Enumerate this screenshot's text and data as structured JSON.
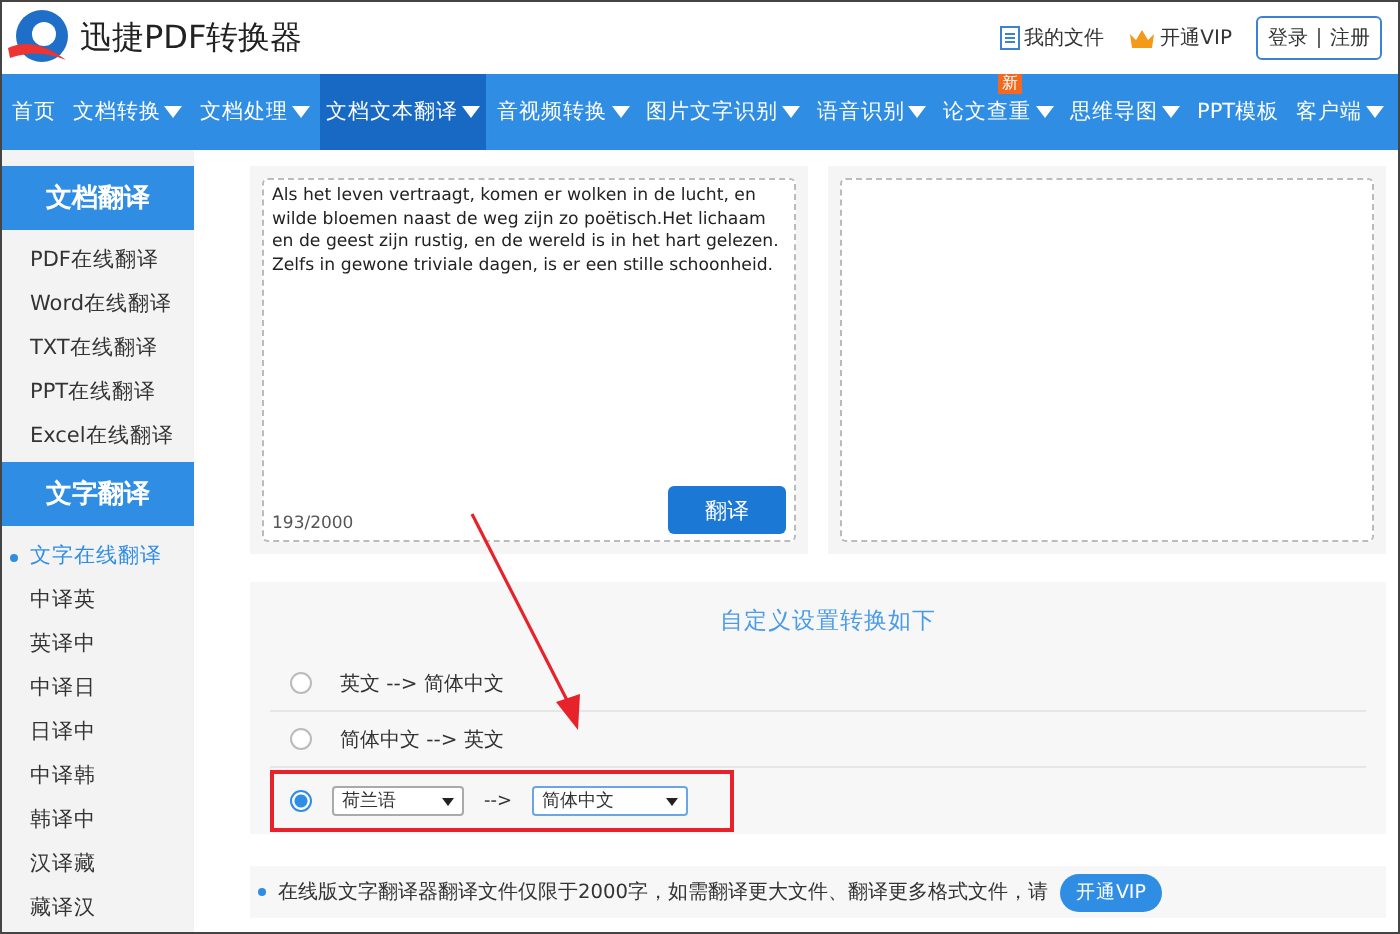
{
  "header": {
    "brand": "迅捷PDF转换器",
    "links": [
      {
        "label": "我的文件",
        "kind": "file"
      },
      {
        "label": "开通VIP",
        "kind": "vip"
      }
    ],
    "login": "登录",
    "register": "注册"
  },
  "nav": [
    {
      "label": "首页",
      "dropdown": false,
      "selected": false
    },
    {
      "label": "文档转换",
      "dropdown": true,
      "selected": false
    },
    {
      "label": "文档处理",
      "dropdown": true,
      "selected": false
    },
    {
      "label": "文档文本翻译",
      "dropdown": true,
      "selected": true
    },
    {
      "label": "音视频转换",
      "dropdown": true,
      "selected": false
    },
    {
      "label": "图片文字识别",
      "dropdown": true,
      "selected": false
    },
    {
      "label": "语音识别",
      "dropdown": true,
      "selected": false
    },
    {
      "label": "论文查重",
      "dropdown": true,
      "selected": false,
      "badge": "新"
    },
    {
      "label": "思维导图",
      "dropdown": true,
      "selected": false
    },
    {
      "label": "PPT模板",
      "dropdown": false,
      "selected": false
    },
    {
      "label": "客户端",
      "dropdown": true,
      "selected": false
    }
  ],
  "sidebar": [
    {
      "title": "文档翻译",
      "items": [
        {
          "label": "PDF在线翻译",
          "selected": false
        },
        {
          "label": "Word在线翻译",
          "selected": false
        },
        {
          "label": "TXT在线翻译",
          "selected": false
        },
        {
          "label": "PPT在线翻译",
          "selected": false
        },
        {
          "label": "Excel在线翻译",
          "selected": false
        }
      ]
    },
    {
      "title": "文字翻译",
      "items": [
        {
          "label": "文字在线翻译",
          "selected": true
        },
        {
          "label": "中译英",
          "selected": false
        },
        {
          "label": "英译中",
          "selected": false
        },
        {
          "label": "中译日",
          "selected": false
        },
        {
          "label": "日译中",
          "selected": false
        },
        {
          "label": "中译韩",
          "selected": false
        },
        {
          "label": "韩译中",
          "selected": false
        },
        {
          "label": "汉译藏",
          "selected": false
        },
        {
          "label": "藏译汉",
          "selected": false
        }
      ]
    }
  ],
  "translator": {
    "input": "Als het leven vertraagt, komen er wolken in de lucht, en wilde bloemen naast de weg zijn zo poëtisch.Het lichaam en de geest zijn rustig, en de wereld is in het hart gelezen. Zelfs in gewone triviale dagen, is er een stille schoonheid.",
    "counter": "193/2000",
    "button": "翻译"
  },
  "settings": {
    "title": "自定义设置转换如下",
    "options": [
      {
        "kind": "text",
        "label": "英文 --> 简体中文",
        "selected": false
      },
      {
        "kind": "text",
        "label": "简体中文 --> 英文",
        "selected": false
      },
      {
        "kind": "selects",
        "from": "荷兰语",
        "separator": "-->",
        "to": "简体中文",
        "selected": true,
        "highlighted": true
      }
    ]
  },
  "notice": {
    "text": "在线版文字翻译器翻译文件仅限于2000字，如需翻译更大文件、翻译更多格式文件，请",
    "button": "开通VIP"
  }
}
